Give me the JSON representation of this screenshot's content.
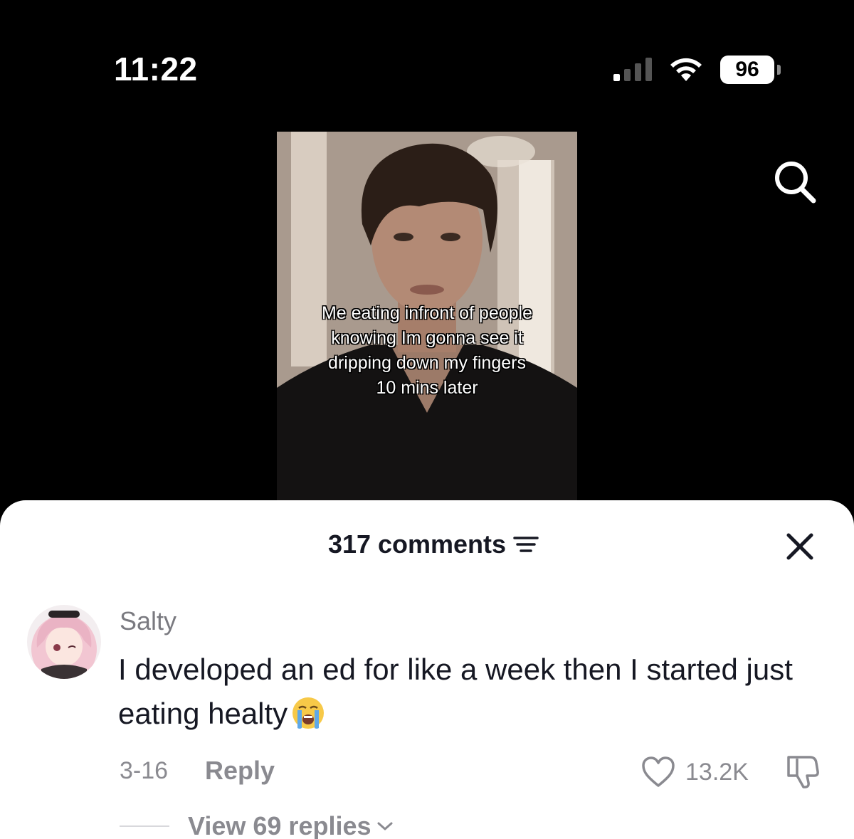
{
  "status_bar": {
    "time": "11:22",
    "battery": "96"
  },
  "video": {
    "caption_lines": [
      "Me eating infront of people",
      "knowing Im gonna see it",
      "dripping down my fingers",
      "10 mins later"
    ]
  },
  "comments": {
    "header": "317 comments",
    "items": [
      {
        "username": "Salty",
        "text": "I developed an ed for like a week then I started just eating healty",
        "emoji": "loudly-crying-face",
        "date": "3-16",
        "reply_label": "Reply",
        "likes": "13.2K",
        "view_replies": "View 69 replies"
      }
    ]
  },
  "icons": [
    "signal-icon",
    "wifi-icon",
    "battery-icon",
    "search-icon",
    "filter-icon",
    "close-icon",
    "heart-icon",
    "dislike-icon",
    "chevron-down-icon"
  ]
}
